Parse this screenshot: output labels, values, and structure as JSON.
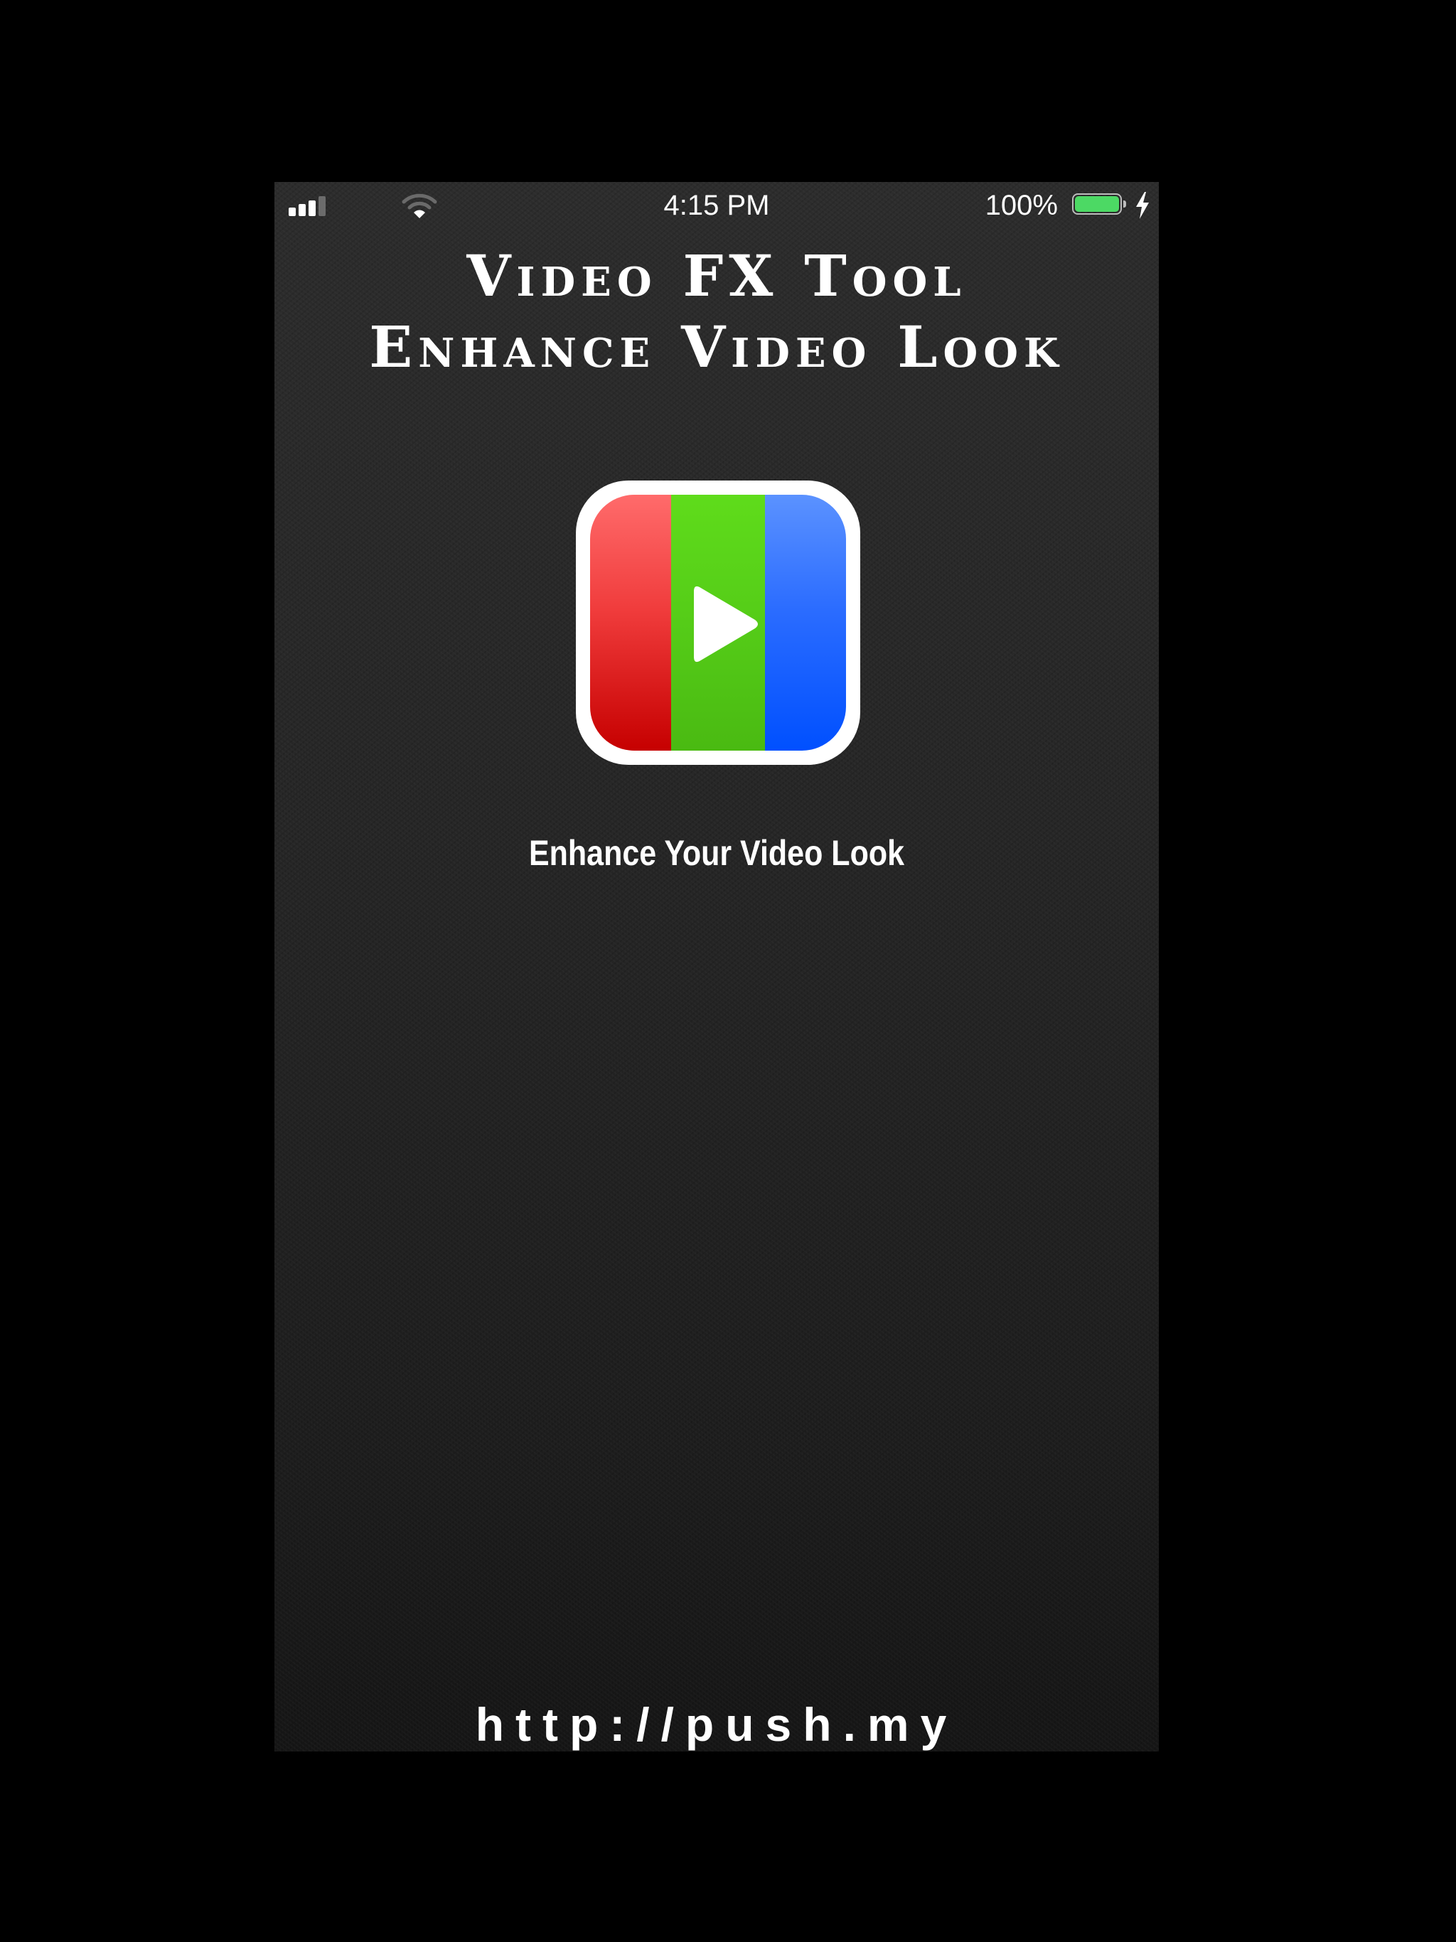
{
  "status_bar": {
    "time": "4:15 PM",
    "battery_percent": "100%",
    "battery_level": 1.0,
    "charging": true,
    "signal_bars_filled": 3,
    "signal_bars_total": 4,
    "icons": [
      "signal-icon",
      "wifi-icon",
      "battery-icon",
      "charging-bolt-icon"
    ]
  },
  "splash": {
    "title_line1": "Video FX Tool",
    "title_line2": "Enhance Video Look",
    "app_icon": {
      "icon": "play-icon",
      "stripe_colors": [
        "#e02424",
        "#52c41a",
        "#1f5fff"
      ]
    },
    "tagline": "Enhance Your Video Look",
    "url": "http://push.my"
  },
  "colors": {
    "background": "#262626",
    "text": "#ffffff",
    "battery_fill": "#4cd964"
  }
}
